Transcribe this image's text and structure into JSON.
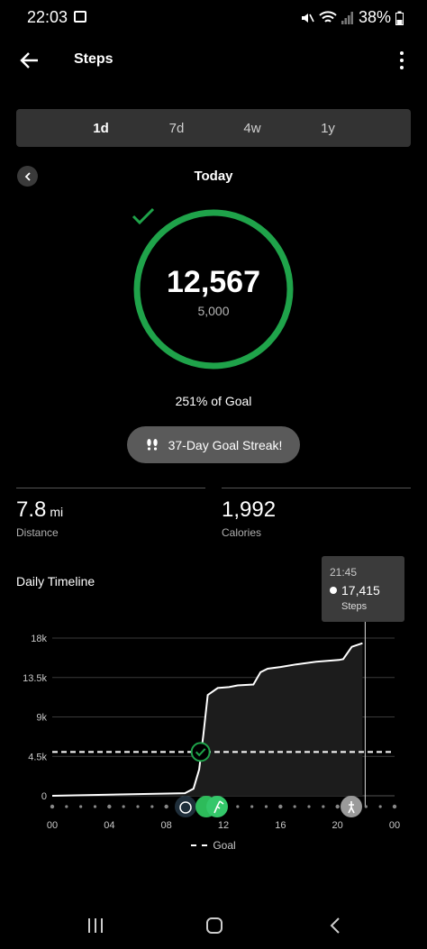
{
  "status_bar": {
    "time": "22:03",
    "battery": "38%"
  },
  "app_bar": {
    "title": "Steps"
  },
  "range_tabs": [
    {
      "label": "1d",
      "active": true
    },
    {
      "label": "7d",
      "active": false
    },
    {
      "label": "4w",
      "active": false
    },
    {
      "label": "1y",
      "active": false
    }
  ],
  "day": {
    "label": "Today"
  },
  "ring": {
    "steps": "12,567",
    "goal": "5,000",
    "progress_fraction": 1.0,
    "color": "#1fa34a"
  },
  "goal_percent": "251% of Goal",
  "streak": {
    "label": "37-Day Goal Streak!"
  },
  "stats": {
    "distance": {
      "value": "7.8",
      "unit": "mi",
      "label": "Distance"
    },
    "calories": {
      "value": "1,992",
      "label": "Calories"
    }
  },
  "timeline": {
    "title": "Daily Timeline",
    "tooltip": {
      "time": "21:45",
      "value": "17,415",
      "unit": "Steps"
    },
    "legend": "Goal",
    "icons": [
      "alarm-icon",
      "running-icon",
      "walking-icon"
    ]
  },
  "chart_data": {
    "type": "area",
    "x_unit": "hour",
    "x": [
      0,
      9.3,
      9.9,
      10.3,
      10.6,
      10.9,
      11.6,
      12.4,
      13.0,
      14.1,
      14.6,
      15.1,
      16.0,
      17.1,
      18.5,
      20.1,
      20.4,
      21.0,
      21.75
    ],
    "y": [
      0,
      300,
      800,
      3000,
      7000,
      11500,
      12300,
      12400,
      12600,
      12700,
      14100,
      14500,
      14700,
      15000,
      15300,
      15500,
      15600,
      17000,
      17415
    ],
    "xlim": [
      0,
      24
    ],
    "ylim": [
      0,
      18000
    ],
    "x_ticks": [
      "00",
      "04",
      "08",
      "12",
      "16",
      "20",
      "00"
    ],
    "y_ticks": [
      "0",
      "4.5k",
      "9k",
      "13.5k",
      "18k"
    ],
    "goal": 5000,
    "goal_reached_hour": 10.4,
    "grid": true
  }
}
